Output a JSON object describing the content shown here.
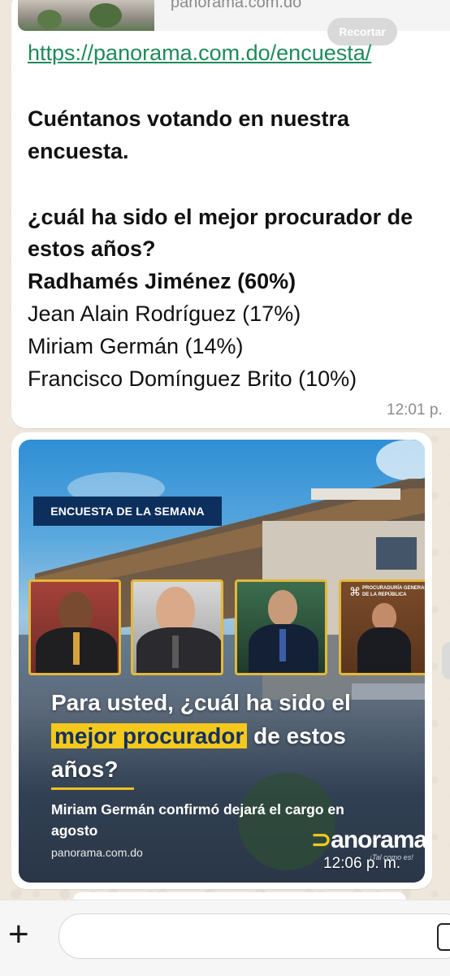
{
  "message1": {
    "preview_domain": "panorama.com.do",
    "recortar_label": "Recortar",
    "link": "https://panorama.com.do/encuesta/",
    "lines": [
      "Cuéntanos votando en nuestra",
      "encuesta.",
      "¿cuál ha sido el mejor procurador de",
      "estos años?"
    ],
    "options": [
      "Radhamés Jiménez (60%)",
      "Jean Alain Rodríguez (17%)",
      "Miriam Germán (14%)",
      "Francisco Domínguez Brito (10%)"
    ],
    "time": "12:01 p."
  },
  "message2": {
    "tag": "ENCUESTA DE LA SEMANA",
    "photo_caption": "PROCURADURÍA GENERAL DE LA REPÚBLICA",
    "headline_pre": "Para usted, ¿cuál ha sido el",
    "headline_highlight": "mejor procurador",
    "headline_post": "de estos años?",
    "subhead": "Miriam Germán confirmó dejará el cargo en agosto",
    "domain": "panorama.com.do",
    "brand": "anorama",
    "brand_mark": "⊃",
    "slogan": "¡Tal como es!",
    "time": "12:06 p. m.",
    "colors": {
      "tag_bg": "#0d2f5e",
      "highlight": "#f4c91c",
      "frame": "#e4b83a"
    }
  },
  "composer": {
    "plus_icon": "+"
  }
}
